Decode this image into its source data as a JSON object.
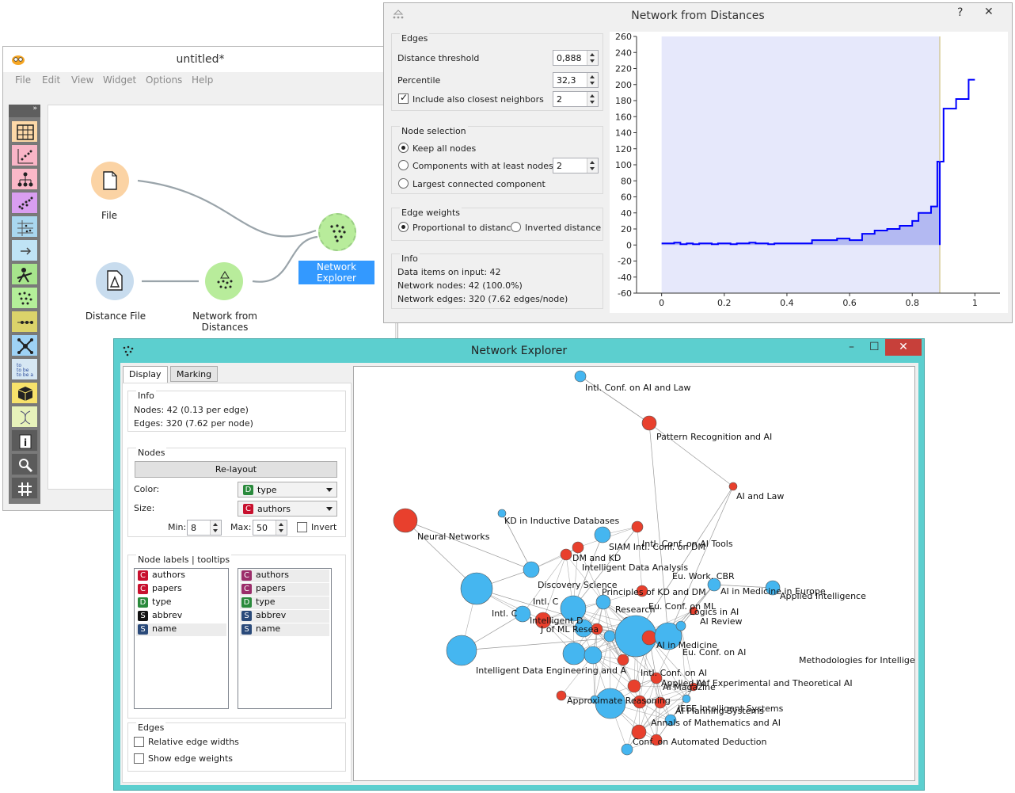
{
  "canvas_window": {
    "title": "untitled*",
    "menu": [
      "File",
      "Edit",
      "View",
      "Widget",
      "Options",
      "Help"
    ],
    "toolbox_toggle": "»",
    "nodes": [
      {
        "label": "File",
        "color": "#fbd3a4"
      },
      {
        "label": "Distance File",
        "color": "#c8dcee"
      },
      {
        "label": "Network from Distances",
        "color": "#b8ec9b"
      },
      {
        "label": "Network Explorer",
        "color": "#b8ec9b",
        "selected": true
      }
    ]
  },
  "nfd_window": {
    "title": "Network from Distances",
    "edges": {
      "title": "Edges",
      "distance_threshold_label": "Distance threshold",
      "distance_threshold_value": "0,888",
      "percentile_label": "Percentile",
      "percentile_value": "32,3",
      "include_neighbors_label": "Include also closest neighbors",
      "include_neighbors_checked": true,
      "include_neighbors_value": "2"
    },
    "node_selection": {
      "title": "Node selection",
      "options": [
        "Keep all nodes",
        "Components with at least nodes",
        "Largest connected component"
      ],
      "selected": 0,
      "components_value": "2"
    },
    "edge_weights": {
      "title": "Edge weights",
      "options": [
        "Proportional to distance",
        "Inverted distance"
      ],
      "selected": 0
    },
    "info": {
      "title": "Info",
      "lines": [
        "Data items on input: 42",
        "Network nodes: 42 (100.0%)",
        "Network edges: 320 (7.62 edges/node)"
      ]
    }
  },
  "chart_data": {
    "type": "line",
    "title": "",
    "xlabel": "",
    "ylabel": "",
    "xlim": [
      -0.08,
      1.08
    ],
    "ylim": [
      -60,
      260
    ],
    "xticks": [
      "0",
      "0.2",
      "0.4",
      "0.6",
      "0.8",
      "1"
    ],
    "yticks": [
      "260",
      "240",
      "220",
      "200",
      "180",
      "160",
      "140",
      "120",
      "100",
      "80",
      "60",
      "40",
      "20",
      "0",
      "-20",
      "-40",
      "-60"
    ],
    "grid": false,
    "threshold": 0.888,
    "series": [
      {
        "color": "#0000ff",
        "x": [
          0.0,
          0.02,
          0.04,
          0.06,
          0.08,
          0.1,
          0.12,
          0.14,
          0.16,
          0.18,
          0.2,
          0.22,
          0.24,
          0.26,
          0.28,
          0.3,
          0.32,
          0.34,
          0.36,
          0.38,
          0.4,
          0.42,
          0.44,
          0.46,
          0.48,
          0.5,
          0.52,
          0.54,
          0.56,
          0.58,
          0.6,
          0.62,
          0.64,
          0.66,
          0.68,
          0.7,
          0.72,
          0.74,
          0.76,
          0.78,
          0.8,
          0.82,
          0.84,
          0.86,
          0.88,
          0.9,
          0.92,
          0.94,
          0.96,
          0.98
        ],
        "values": [
          2,
          2,
          3,
          1,
          2,
          1,
          2,
          2,
          1,
          2,
          2,
          1,
          2,
          2,
          3,
          2,
          2,
          1,
          2,
          2,
          2,
          2,
          2,
          2,
          6,
          6,
          6,
          6,
          8,
          8,
          6,
          6,
          14,
          14,
          18,
          18,
          20,
          20,
          24,
          24,
          30,
          40,
          40,
          48,
          104,
          170,
          170,
          182,
          182,
          206
        ]
      }
    ]
  },
  "ne_window": {
    "title": "Network Explorer",
    "tabs": [
      "Display",
      "Marking"
    ],
    "info": {
      "title": "Info",
      "nodes": "Nodes: 42 (0.13 per edge)",
      "edges": "Edges: 320 (7.62 per node)"
    },
    "nodes_box": {
      "title": "Nodes",
      "relayout": "Re-layout",
      "color_label": "Color:",
      "color_value": "type",
      "color_badge": "D",
      "size_label": "Size:",
      "size_value": "authors",
      "size_badge": "C",
      "min_label": "Min:",
      "min_value": "8",
      "max_label": "Max:",
      "max_value": "50",
      "invert_label": "Invert"
    },
    "labels_box": {
      "title": "Node labels | tooltips",
      "attributes": [
        {
          "badge": "C",
          "name": "authors",
          "color": "#c8102e"
        },
        {
          "badge": "C",
          "name": "papers",
          "color": "#c8102e"
        },
        {
          "badge": "D",
          "name": "type",
          "color": "#2a8a3c"
        },
        {
          "badge": "S",
          "name": "abbrev",
          "color": "#111111"
        },
        {
          "badge": "S",
          "name": "name",
          "color": "#2a4a7a"
        }
      ],
      "tooltip_attributes": [
        {
          "badge": "C",
          "name": "authors",
          "color": "#9b2d6a"
        },
        {
          "badge": "C",
          "name": "papers",
          "color": "#9b2d6a"
        },
        {
          "badge": "D",
          "name": "type",
          "color": "#2a8a3c"
        },
        {
          "badge": "S",
          "name": "abbrev",
          "color": "#2a4a7a"
        },
        {
          "badge": "S",
          "name": "name",
          "color": "#2a4a7a"
        }
      ]
    },
    "edges_box": {
      "title": "Edges",
      "relative": "Relative edge widths",
      "show_weights": "Show edge weights"
    },
    "graph_labels": [
      "Intl. Conf. on AI and Law",
      "Pattern Recognition and AI",
      "AI and Law",
      "Neural Networks",
      "KD in Inductive Databases",
      "Intl. Conf. on AI Tools",
      "SIAM Intl. Conf. on DM",
      "Intelligent Data Analysis",
      "DM and KD",
      "Discovery Science",
      "Principles of KD and DM",
      "Eu. Work. CBR",
      "AI in Medicine in Europe",
      "Applied Intelligence",
      "Eu. Conf. on ML",
      "AI Review",
      "Logics in AI",
      "Intl. C",
      "Intelligent D",
      "J of ML Resea",
      "Intl. C",
      "Research",
      "AI in Medicine",
      "Eu. Conf. on AI",
      "Methodologies for Intelligent Systems",
      "Intelligent Data Engineering and A",
      "Intl. Conf. on AI",
      "Applied AI",
      "J of Experimental and Theoretical AI",
      "AI Magazine",
      "Approximate Reasoning",
      "IEEE Intelligent Systems",
      "AI Planning Systems",
      "Annals of Mathematics and AI",
      "Conf. on Automated Deduction"
    ],
    "node_colors": {
      "blue": "#45b6f0",
      "red": "#e8402d"
    }
  }
}
